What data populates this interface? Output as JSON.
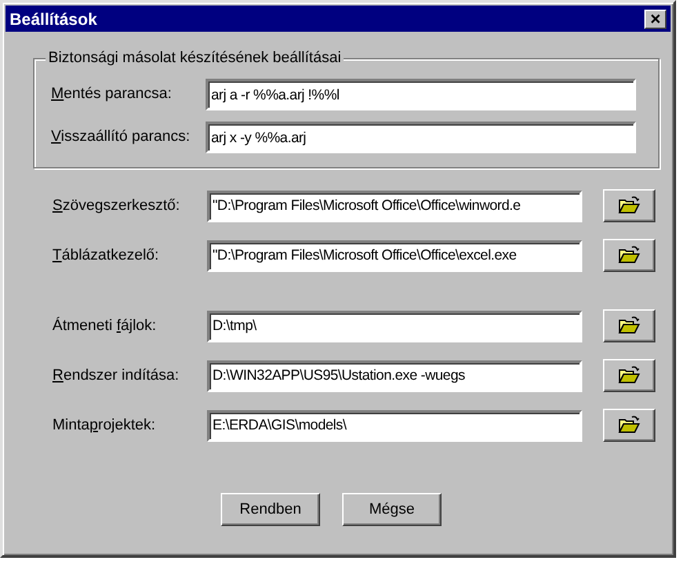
{
  "window": {
    "title": "Beállítások",
    "close": "×"
  },
  "backup_group": {
    "title": "Biztonsági másolat készítésének beállításai",
    "fields": [
      {
        "label": {
          "key": "M",
          "after": "entés parancsa:"
        },
        "value": "arj a -r %%a.arj !%%l"
      },
      {
        "label": {
          "key": "V",
          "after": "isszaállító parancs:"
        },
        "value": "arj x -y %%a.arj"
      }
    ]
  },
  "program_fields": [
    {
      "label": {
        "key": "S",
        "after": "zövegszerkesztő:"
      },
      "value": "\"D:\\Program Files\\Microsoft Office\\Office\\winword.e"
    },
    {
      "label": {
        "key": "T",
        "after": "áblázatkezelő:"
      },
      "value": "\"D:\\Program Files\\Microsoft Office\\Office\\excel.exe"
    }
  ],
  "path_fields": [
    {
      "label": {
        "before": "Átmeneti ",
        "key": "f",
        "after": "ájlok:"
      },
      "value": "D:\\tmp\\"
    },
    {
      "label": {
        "key": "R",
        "after": "endszer indítása:"
      },
      "value": "D:\\WIN32APP\\US95\\Ustation.exe -wuegs"
    },
    {
      "label": {
        "before": "Minta",
        "key": "p",
        "after": "rojektek:"
      },
      "value": "E:\\ERDA\\GIS\\models\\"
    }
  ],
  "buttons": [
    "Rendben",
    "Mégse"
  ]
}
